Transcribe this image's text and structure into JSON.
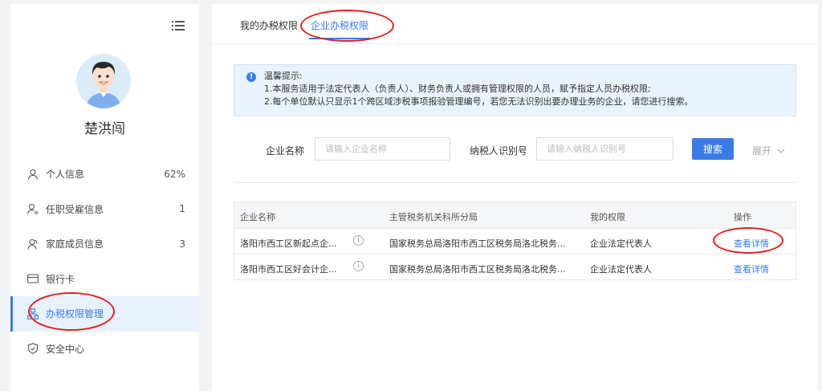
{
  "sidebar": {
    "username": "楚洪闯",
    "items": [
      {
        "label": "个人信息",
        "count": "62%",
        "icon": "user-icon"
      },
      {
        "label": "任职受雇信息",
        "count": "1",
        "icon": "user-list-icon"
      },
      {
        "label": "家庭成员信息",
        "count": "3",
        "icon": "family-icon"
      },
      {
        "label": "银行卡",
        "count": "",
        "icon": "card-icon"
      },
      {
        "label": "办税权限管理",
        "count": "",
        "icon": "org-icon"
      },
      {
        "label": "安全中心",
        "count": "",
        "icon": "shield-icon"
      }
    ]
  },
  "tabs": [
    {
      "label": "我的办税权限"
    },
    {
      "label": "企业办税权限"
    }
  ],
  "notice": {
    "title": "温馨提示:",
    "line1": "1.本服务适用于法定代表人（负责人）、财务负责人或拥有管理权限的人员，赋予指定人员办税权限;",
    "line2": "2.每个单位默认只显示1个跨区域涉税事项报验管理编号，若您无法识别出要办理业务的企业，请您进行搜索。"
  },
  "search": {
    "company_label": "企业名称",
    "company_placeholder": "请输入企业名称",
    "taxid_label": "纳税人识别号",
    "taxid_placeholder": "请输入纳税人识别号",
    "search_button": "搜索",
    "expand_label": "展开"
  },
  "table": {
    "headers": [
      "企业名称",
      "主管税务机关科所分局",
      "我的权限",
      "操作"
    ],
    "rows": [
      {
        "company": "洛阳市西工区新起点企...",
        "bureau": "国家税务总局洛阳市西工区税务局洛北税务...",
        "permission": "企业法定代表人",
        "action": "查看详情"
      },
      {
        "company": "洛阳市西工区好会计企...",
        "bureau": "国家税务总局洛阳市西工区税务局洛北税务...",
        "permission": "企业法定代表人",
        "action": "查看详情"
      }
    ]
  },
  "colors": {
    "accent": "#3a7be6",
    "annotation": "#e02020",
    "notice_bg": "#e9f3fd"
  }
}
